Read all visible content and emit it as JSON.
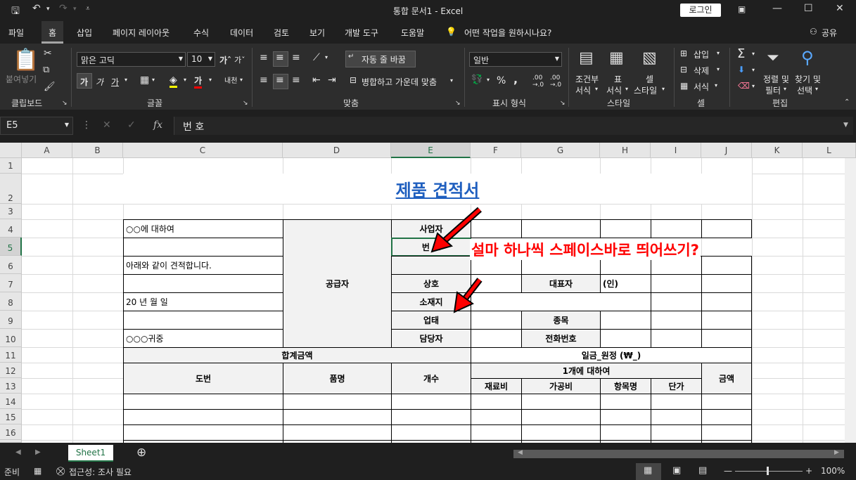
{
  "title_bar": {
    "title": "통합 문서1  -  Excel",
    "login": "로그인"
  },
  "tabs": [
    "파일",
    "홈",
    "삽입",
    "페이지 레이아웃",
    "수식",
    "데이터",
    "검토",
    "보기",
    "개발 도구",
    "도움말"
  ],
  "tell_me": "어떤 작업을 원하시나요?",
  "share": "공유",
  "ribbon": {
    "paste": "붙여넣기",
    "clipboard_group": "클립보드",
    "font_name": "맑은 고딕",
    "font_size": "10",
    "font_group": "글꼴",
    "wrap_text": "자동 줄 바꿈",
    "merge_center": "병합하고 가운데 맞춤",
    "align_group": "맞춤",
    "number_format": "일반",
    "number_group": "표시 형식",
    "cond_format": "조건부",
    "cond_format2": "서식",
    "table_format": "표",
    "table_format2": "서식",
    "cell_style": "셀",
    "cell_style2": "스타일",
    "style_group": "스타일",
    "insert": "삽입",
    "delete": "삭제",
    "format": "서식",
    "cells_group": "셀",
    "sort_filter": "정렬 및",
    "sort_filter2": "필터",
    "find_select": "찾기 및",
    "find_select2": "선택",
    "edit_group": "편집"
  },
  "formula_bar": {
    "name_box": "E5",
    "content": "번  호"
  },
  "columns": [
    "A",
    "B",
    "C",
    "D",
    "E",
    "F",
    "G",
    "H",
    "I",
    "J",
    "K",
    "L"
  ],
  "rows": [
    "1",
    "2",
    "3",
    "4",
    "5",
    "6",
    "7",
    "8",
    "9",
    "10",
    "11",
    "12",
    "13",
    "14",
    "15",
    "16"
  ],
  "sheet": {
    "title": "제품 견적서",
    "c4": "○○에 대하여",
    "c6": "아래와 같이 견적합니다.",
    "c8": "20  년  월  일",
    "c10": "○○○귀중",
    "supplier": "공급자",
    "e4": "사업자",
    "e5": "번  호",
    "e7": "상호",
    "g7": "대표자",
    "h7": "(인)",
    "e8": "소재지",
    "e9": "업태",
    "g9": "종목",
    "e10": "담당자",
    "g10": "전화번호",
    "total_label": "합계금액",
    "total_value": "일금_원정 (₩_)",
    "h_drawing": "도번",
    "h_item": "품명",
    "h_qty": "개수",
    "h_per": "1개에 대하여",
    "h_amount": "금액",
    "h_material": "재료비",
    "h_process": "가공비",
    "h_itemname": "항목명",
    "h_unit": "단가"
  },
  "annotation": "설마 하나씩 스페이스바로 띄어쓰기?",
  "sheet_tab": "Sheet1",
  "status": {
    "ready": "준비",
    "accessibility": "접근성: 조사 필요",
    "zoom": "100%"
  },
  "colors": {
    "accent": "#217346",
    "title_blue": "#1f5fbf",
    "annotation_red": "#ff0000"
  }
}
